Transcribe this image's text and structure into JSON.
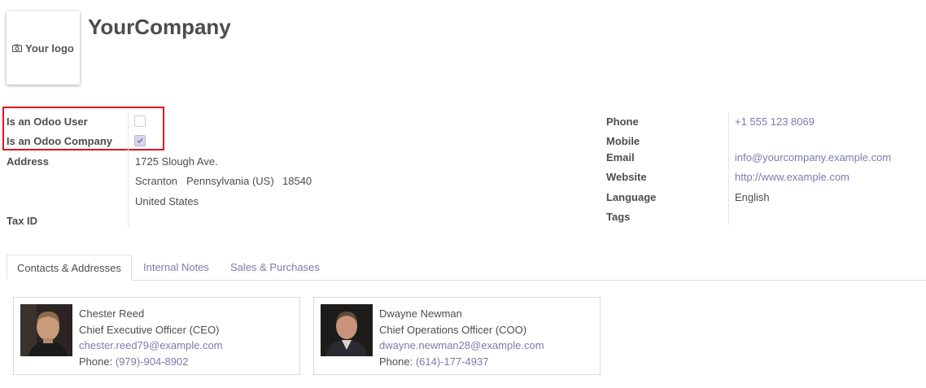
{
  "logo": {
    "text": "Your logo",
    "icon": "camera-icon"
  },
  "company": {
    "name": "YourCompany"
  },
  "left_fields": {
    "odoo_user_label": "Is an Odoo User",
    "odoo_user_checked": false,
    "odoo_company_label": "Is an Odoo Company",
    "odoo_company_checked": true,
    "address_label": "Address",
    "street": "1725 Slough Ave.",
    "city": "Scranton",
    "state": "Pennsylvania (US)",
    "zip": "18540",
    "country": "United States",
    "tax_id_label": "Tax ID"
  },
  "right_fields": {
    "phone_label": "Phone",
    "phone": "+1 555 123 8069",
    "mobile_label": "Mobile",
    "email_label": "Email",
    "email": "info@yourcompany.example.com",
    "website_label": "Website",
    "website": "http://www.example.com",
    "language_label": "Language",
    "language": "English",
    "tags_label": "Tags"
  },
  "tabs": [
    {
      "label": "Contacts & Addresses",
      "active": true
    },
    {
      "label": "Internal Notes",
      "active": false
    },
    {
      "label": "Sales & Purchases",
      "active": false
    }
  ],
  "contacts": [
    {
      "name": "Chester Reed",
      "title": "Chief Executive Officer (CEO)",
      "email": "chester.reed79@example.com",
      "phone_label": "Phone: ",
      "phone": "(979)-904-8902"
    },
    {
      "name": "Dwayne Newman",
      "title": "Chief Operations Officer (COO)",
      "email": "dwayne.newman28@example.com",
      "phone_label": "Phone: ",
      "phone": "(614)-177-4937"
    }
  ],
  "colors": {
    "link": "#7c7bad",
    "highlight": "#e3141c",
    "text": "#4c4c4c"
  }
}
